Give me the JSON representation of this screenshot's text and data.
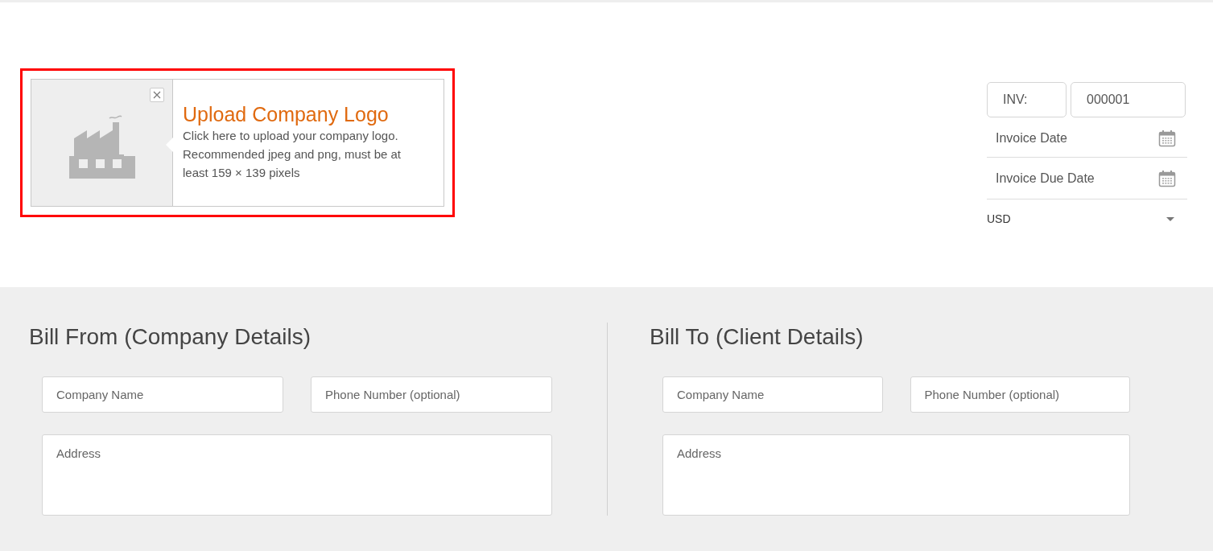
{
  "logo_upload": {
    "title": "Upload Company Logo",
    "description": "Click here to upload your company logo. Recommended jpeg and png, must be at least 159 × 139 pixels",
    "highlighted": true
  },
  "invoice": {
    "prefix": "INV:",
    "number": "000001",
    "date_placeholder": "Invoice Date",
    "due_date_placeholder": "Invoice Due Date",
    "currency": "USD"
  },
  "sections": [
    {
      "title": "Bill From (Company Details)",
      "fields": [
        {
          "kind": "input",
          "placeholder": "Company Name"
        },
        {
          "kind": "input",
          "placeholder": "Phone Number (optional)"
        },
        {
          "kind": "textarea",
          "placeholder": "Address"
        }
      ]
    },
    {
      "title": "Bill To (Client Details)",
      "fields": [
        {
          "kind": "input",
          "placeholder": "Company Name"
        },
        {
          "kind": "input",
          "placeholder": "Phone Number (optional)"
        },
        {
          "kind": "textarea",
          "placeholder": "Address"
        }
      ]
    }
  ]
}
